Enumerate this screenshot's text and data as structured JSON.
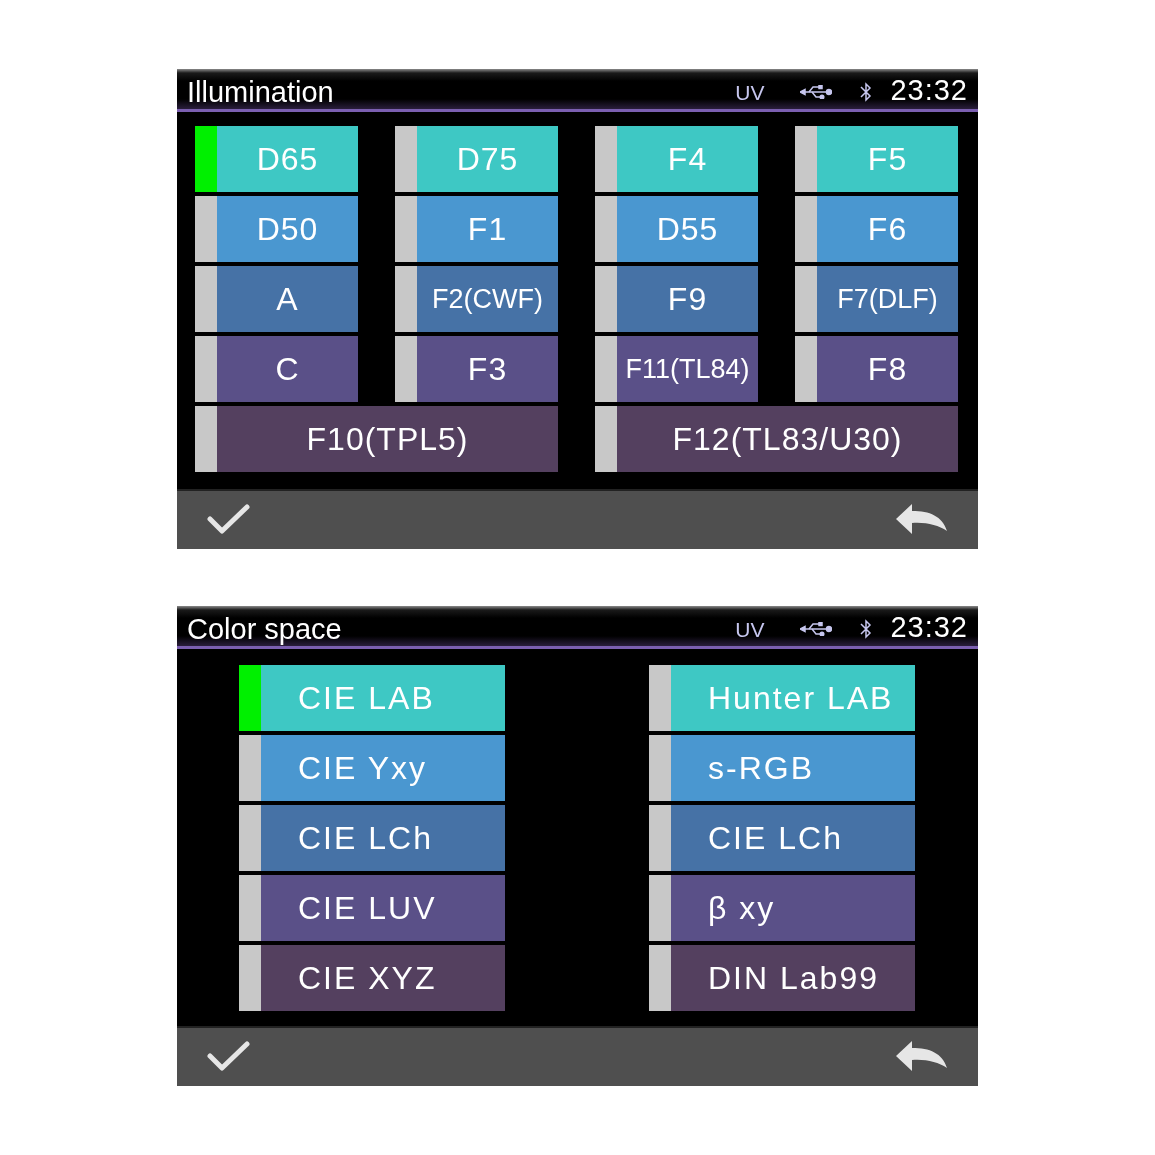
{
  "panels": [
    {
      "title": "Illumination",
      "status": {
        "uv": "UV",
        "time": "23:32"
      },
      "kind": "grid",
      "items": [
        {
          "label": "D65",
          "selected": true
        },
        {
          "label": "D75",
          "selected": false
        },
        {
          "label": "F4",
          "selected": false
        },
        {
          "label": "F5",
          "selected": false
        },
        {
          "label": "D50",
          "selected": false
        },
        {
          "label": "F1",
          "selected": false
        },
        {
          "label": "D55",
          "selected": false
        },
        {
          "label": "F6",
          "selected": false
        },
        {
          "label": "A",
          "selected": false
        },
        {
          "label": "F2(CWF)",
          "selected": false
        },
        {
          "label": "F9",
          "selected": false
        },
        {
          "label": "F7(DLF)",
          "selected": false
        },
        {
          "label": "C",
          "selected": false
        },
        {
          "label": "F3",
          "selected": false
        },
        {
          "label": "F11(TL84)",
          "selected": false
        },
        {
          "label": "F8",
          "selected": false
        },
        {
          "label": "F10(TPL5)",
          "selected": false,
          "wide": true
        },
        {
          "label": "F12(TL83/U30)",
          "selected": false,
          "wide": true
        }
      ]
    },
    {
      "title": "Color space",
      "status": {
        "uv": "UV",
        "time": "23:32"
      },
      "kind": "columns",
      "items": [
        {
          "label": "CIE LAB",
          "selected": true
        },
        {
          "label": "Hunter LAB",
          "selected": false
        },
        {
          "label": "CIE Yxy",
          "selected": false
        },
        {
          "label": "s-RGB",
          "selected": false
        },
        {
          "label": "CIE LCh",
          "selected": false
        },
        {
          "label": "CIE LCh",
          "selected": false
        },
        {
          "label": "CIE LUV",
          "selected": false
        },
        {
          "label": "β xy",
          "selected": false
        },
        {
          "label": "CIE XYZ",
          "selected": false
        },
        {
          "label": "DIN Lab99",
          "selected": false
        }
      ]
    }
  ]
}
